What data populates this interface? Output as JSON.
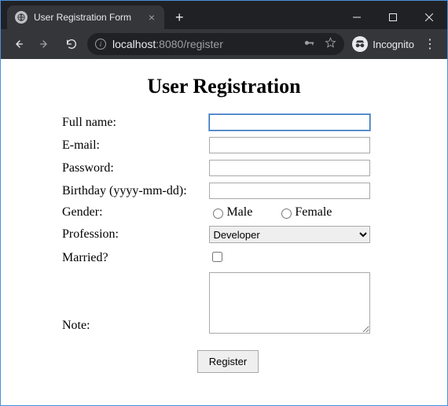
{
  "browser": {
    "tab_title": "User Registration Form",
    "url_host": "localhost",
    "url_port": ":8080",
    "url_path": "/register",
    "incognito_label": "Incognito"
  },
  "page": {
    "heading": "User Registration",
    "labels": {
      "fullname": "Full name:",
      "email": "E-mail:",
      "password": "Password:",
      "birthday": "Birthday (yyyy-mm-dd):",
      "gender": "Gender:",
      "profession": "Profession:",
      "married": "Married?",
      "note": "Note:"
    },
    "gender_options": {
      "male": "Male",
      "female": "Female"
    },
    "profession_selected": "Developer",
    "submit_label": "Register"
  }
}
